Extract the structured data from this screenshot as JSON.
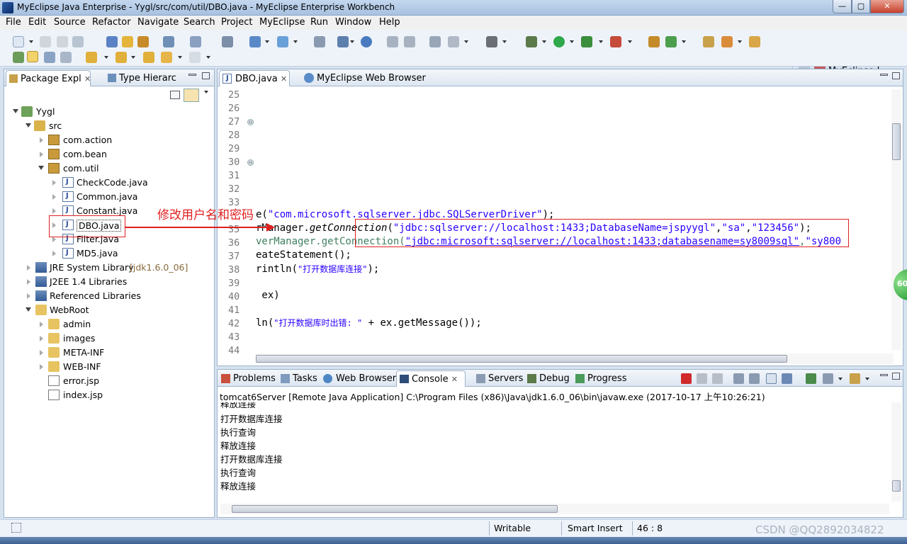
{
  "window": {
    "title": "MyEclipse Java Enterprise - Yygl/src/com/util/DBO.java - MyEclipse Enterprise Workbench",
    "min": "—",
    "max": "▢",
    "close": "✕"
  },
  "menu": [
    "File",
    "Edit",
    "Source",
    "Refactor",
    "Navigate",
    "Search",
    "Project",
    "MyEclipse",
    "Run",
    "Window",
    "Help"
  ],
  "perspective": {
    "label": "MyEclipse I..."
  },
  "package_explorer": {
    "tabs": [
      {
        "label": "Package Expl",
        "close": "✕"
      },
      {
        "label": "Type Hierarc"
      }
    ],
    "tree": [
      {
        "label": "Yygl"
      },
      {
        "label": "src"
      },
      {
        "label": "com.action"
      },
      {
        "label": "com.bean"
      },
      {
        "label": "com.util"
      },
      {
        "label": "CheckCode.java"
      },
      {
        "label": "Common.java"
      },
      {
        "label": "Constant.java"
      },
      {
        "label": "DBO.java"
      },
      {
        "label": "Filter.java"
      },
      {
        "label": "MD5.java"
      },
      {
        "label": "JRE System Library",
        "extra": "[jdk1.6.0_06]"
      },
      {
        "label": "J2EE 1.4 Libraries"
      },
      {
        "label": "Referenced Libraries"
      },
      {
        "label": "WebRoot"
      },
      {
        "label": "admin"
      },
      {
        "label": "images"
      },
      {
        "label": "META-INF"
      },
      {
        "label": "WEB-INF"
      },
      {
        "label": "error.jsp"
      },
      {
        "label": "index.jsp"
      }
    ]
  },
  "editor": {
    "tabs": [
      {
        "label": "DBO.java",
        "close": "✕"
      },
      {
        "label": "MyEclipse Web Browser"
      }
    ],
    "line_numbers": [
      "25",
      "26",
      "27",
      "28",
      "29",
      "30",
      "31",
      "32",
      "33",
      "35",
      "36",
      "37",
      "38",
      "39",
      "40",
      "41",
      "42",
      "43",
      "44"
    ],
    "fold_markers": [
      "⊖",
      "⊖"
    ],
    "code": {
      "l34_a": "e(",
      "l34_str": "\"com.microsoft.sqlserver.jdbc.SQLServerDriver\"",
      "l34_b": ");",
      "l35_a": "rManager.",
      "l35_method": "getConnection",
      "l35_b": "(",
      "l35_s1": "\"jdbc:sqlserver://localhost:1433;DatabaseName=jspyygl\"",
      "l35_c1": ",",
      "l35_s2": "\"sa\"",
      "l35_c2": ",",
      "l35_s3": "\"123456\"",
      "l35_d": ");",
      "l36_a": "verManager.getConnection(",
      "l36_s": "\"jdbc:microsoft:sqlserver://localhost:1433;databasename=sy8009sql\"",
      "l36_b": ",",
      "l36_c": "\"sy800",
      "l37": "eateStatement();",
      "l38_a": "rintln(",
      "l38_str": "\"打开数据库连接\"",
      "l38_b": ");",
      "l40": " ex)",
      "l42_a": "ln(",
      "l42_str": "\"打开数据库时出错: \"",
      "l42_b": " + ex.getMessage());"
    }
  },
  "annotation": {
    "text": "修改用户名和密码"
  },
  "console": {
    "tabs": [
      "Problems",
      "Tasks",
      "Web Browser",
      "Console",
      "Servers",
      "Debug",
      "Progress"
    ],
    "console_close": "✕",
    "header": "tomcat6Server [Remote Java Application] C:\\Program Files (x86)\\Java\\jdk1.6.0_06\\bin\\javaw.exe (2017-10-17 上午10:26:21)",
    "lines": [
      "释放连接",
      "打开数据库连接",
      "执行查询",
      "释放连接",
      "打开数据库连接",
      "执行查询",
      "释放连接"
    ]
  },
  "status": {
    "writable": "Writable",
    "insert_mode": "Smart Insert",
    "position": "46 : 8"
  },
  "watermark": "CSDN @QQ2892034822",
  "badge": "60"
}
